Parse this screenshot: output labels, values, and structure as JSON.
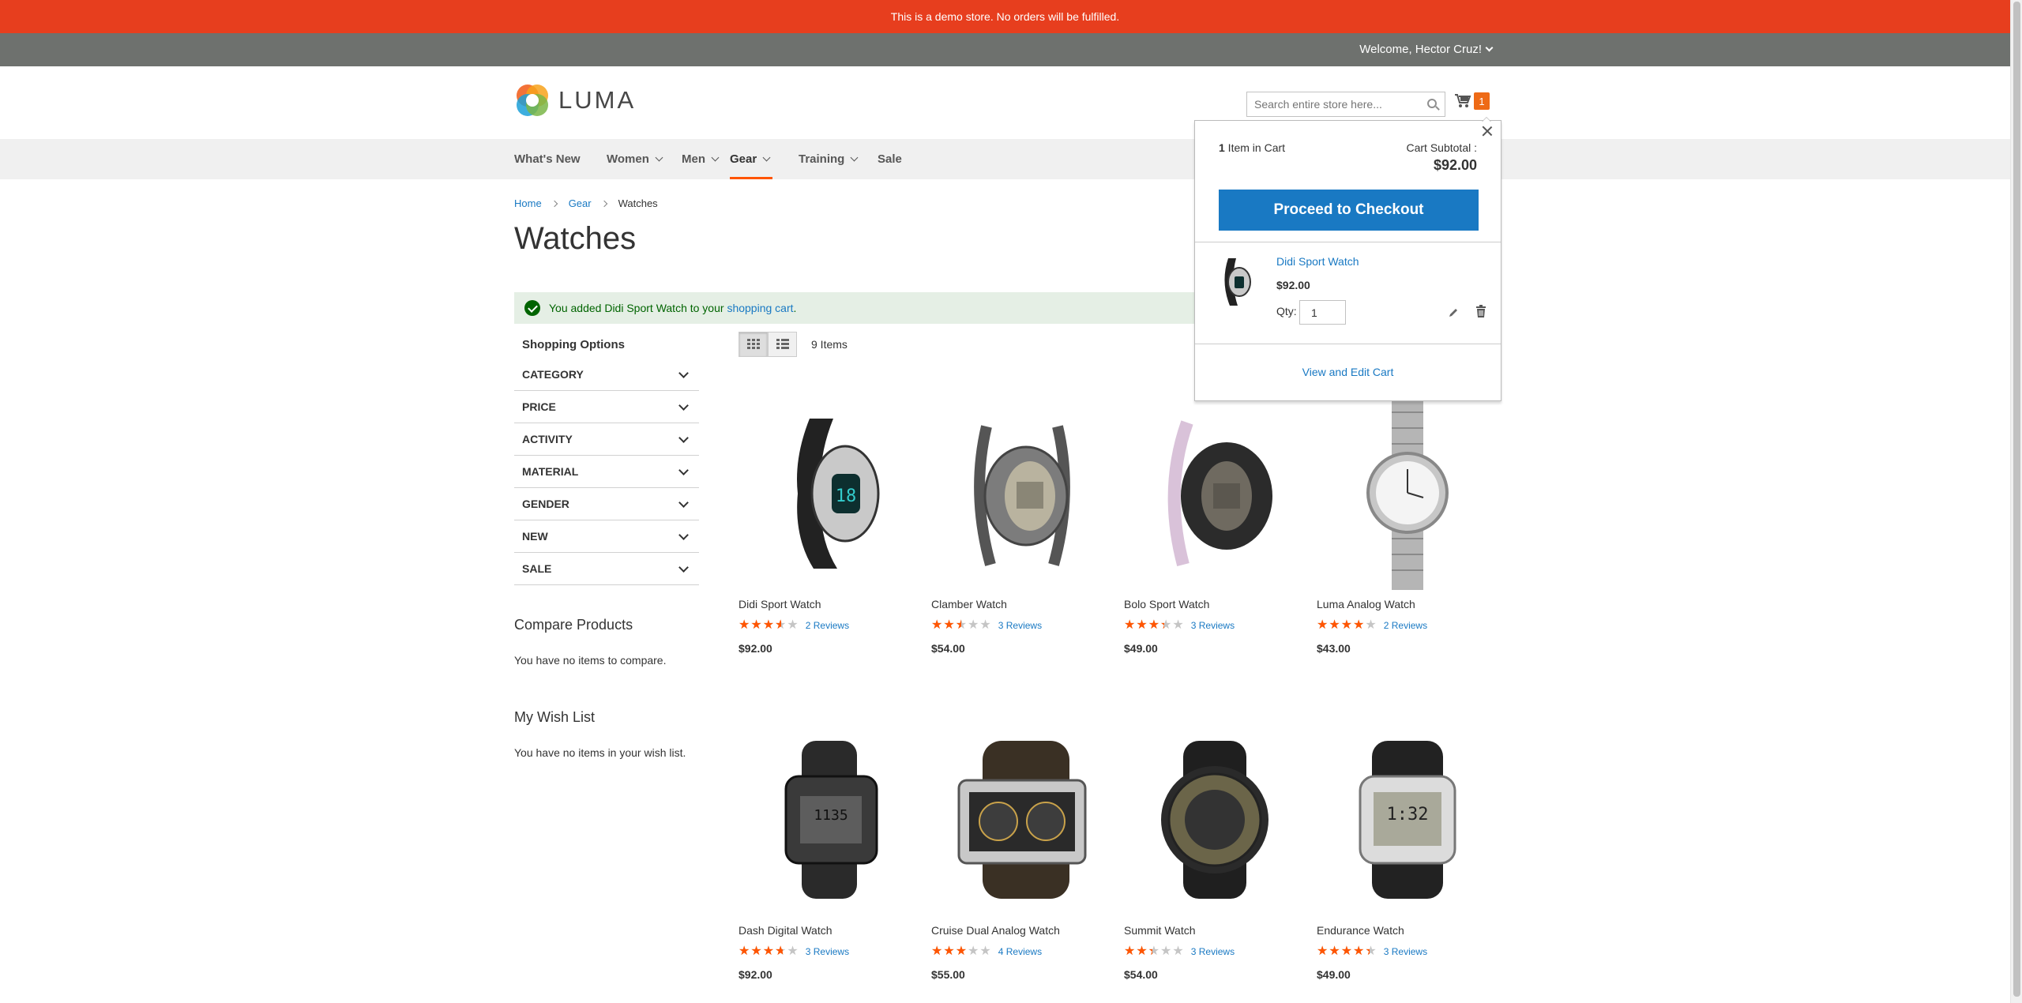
{
  "demo_notice": "This is a demo store. No orders will be fulfilled.",
  "welcome": "Welcome, Hector Cruz!",
  "logo_text": "LUMA",
  "search": {
    "placeholder": "Search entire store here..."
  },
  "cart": {
    "count": "1"
  },
  "nav": [
    {
      "label": "What's New"
    },
    {
      "label": "Women"
    },
    {
      "label": "Men"
    },
    {
      "label": "Gear"
    },
    {
      "label": "Training"
    },
    {
      "label": "Sale"
    }
  ],
  "breadcrumbs": {
    "home": "Home",
    "gear": "Gear",
    "current": "Watches"
  },
  "page_title": "Watches",
  "message": {
    "prefix": "You added Didi Sport Watch to your ",
    "link": "shopping cart",
    "suffix": "."
  },
  "sidebar": {
    "title": "Shopping Options",
    "filters": [
      "Category",
      "Price",
      "Activity",
      "Material",
      "Gender",
      "New",
      "Sale"
    ],
    "compare_title": "Compare Products",
    "compare_text": "You have no items to compare.",
    "wishlist_title": "My Wish List",
    "wishlist_text": "You have no items in your wish list."
  },
  "toolbar": {
    "amount": "9 Items"
  },
  "products": [
    {
      "name": "Didi Sport Watch",
      "rating_pct": 70,
      "reviews": "2 Reviews",
      "price": "$92.00"
    },
    {
      "name": "Clamber Watch",
      "rating_pct": 50,
      "reviews": "3 Reviews",
      "price": "$54.00"
    },
    {
      "name": "Bolo Sport Watch",
      "rating_pct": 67,
      "reviews": "3 Reviews",
      "price": "$49.00"
    },
    {
      "name": "Luma Analog Watch",
      "rating_pct": 80,
      "reviews": "2 Reviews",
      "price": "$43.00"
    },
    {
      "name": "Dash Digital Watch",
      "rating_pct": 73,
      "reviews": "3 Reviews",
      "price": "$92.00"
    },
    {
      "name": "Cruise Dual Analog Watch",
      "rating_pct": 60,
      "reviews": "4 Reviews",
      "price": "$55.00"
    },
    {
      "name": "Summit Watch",
      "rating_pct": 47,
      "reviews": "3 Reviews",
      "price": "$54.00"
    },
    {
      "name": "Endurance Watch",
      "rating_pct": 87,
      "reviews": "3 Reviews",
      "price": "$49.00"
    }
  ],
  "minicart": {
    "count": "1",
    "count_label": " Item in Cart",
    "subtotal_label": "Cart Subtotal :",
    "subtotal": "$92.00",
    "checkout": "Proceed to Checkout",
    "item_name": "Didi Sport Watch",
    "item_price": "$92.00",
    "qty_label": "Qty:",
    "qty": "1",
    "view_edit": "View and Edit Cart"
  },
  "colors": {
    "demo_bar": "#e73e1e",
    "accent": "#ff5501",
    "link": "#1979c3",
    "button": "#1979c3",
    "success_bg": "#e5efe5"
  }
}
